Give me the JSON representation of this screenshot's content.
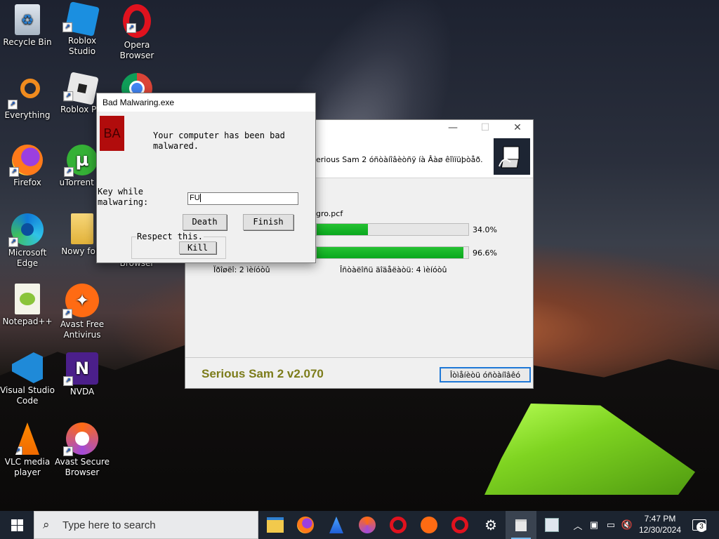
{
  "desktop": {
    "icons": [
      {
        "label": "Recycle Bin",
        "icon": "recycle-bin-icon"
      },
      {
        "label": "Roblox Studio",
        "icon": "roblox-studio-icon"
      },
      {
        "label": "Opera Browser",
        "icon": "opera-icon"
      },
      {
        "label": "Everything",
        "icon": "everything-search-icon"
      },
      {
        "label": "Roblox Pla",
        "icon": "roblox-player-icon"
      },
      {
        "label": "Browser",
        "icon": "chrome-icon"
      },
      {
        "label": "Firefox",
        "icon": "firefox-icon"
      },
      {
        "label": "uTorrent W",
        "icon": "utorrent-icon"
      },
      {
        "label": "Microsoft Edge",
        "icon": "edge-icon"
      },
      {
        "label": "Nowy fold",
        "icon": "folder-icon"
      },
      {
        "label": "Notepad++",
        "icon": "notepadpp-icon"
      },
      {
        "label": "Avast Free Antivirus",
        "icon": "avast-icon"
      },
      {
        "label": "Visual Studio Code",
        "icon": "vscode-icon"
      },
      {
        "label": "NVDA",
        "icon": "nvda-icon"
      },
      {
        "label": "VLC media player",
        "icon": "vlc-icon"
      },
      {
        "label": "Avast Secure Browser",
        "icon": "avast-secure-browser-icon"
      }
    ]
  },
  "installer": {
    "header_text": "erious Sam 2 óñòàíîâèòñÿ íà Âàø êîìïüþòåð.",
    "file_name": "gro.pcf",
    "progress1": {
      "value": 0.34,
      "label": "34.0%"
    },
    "progress2": {
      "value": 0.966,
      "label": "96.6%"
    },
    "stat_left": "Ïðîøëî:  2 ìèíóòû",
    "stat_right": "Îñòàëîñü äîäåëàòü:  4 ìèíóòû",
    "brand": "Serious Sam 2  v2.070",
    "cancel_label": "Îòìåíèòü óñòàíîâêó"
  },
  "dialog": {
    "title": "Bad Malwaring.exe",
    "badge": "BA",
    "message": "Your computer has been bad malwared.",
    "key_label": "Key while malwaring:",
    "key_value": "FU",
    "death_label": "Death",
    "finish_label": "Finish",
    "group_label": "Respect this.",
    "kill_label": "Kill"
  },
  "taskbar": {
    "search_placeholder": "Type here to search",
    "time": "7:47 PM",
    "date": "12/30/2024",
    "notification_count": "3",
    "colors": {
      "background": "#1c2430",
      "accent": "#76b9ed"
    }
  }
}
